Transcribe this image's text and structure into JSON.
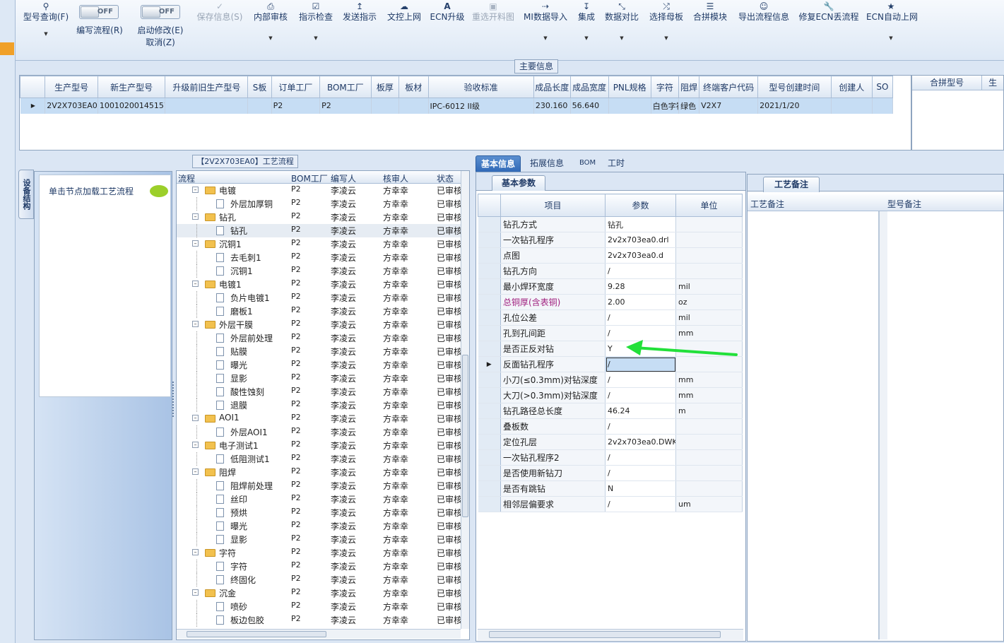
{
  "toolbar": {
    "model_query": "型号查询(F)",
    "write_flow": "编写流程(R)",
    "auto_modify": "启动修改(E)",
    "cancel": "取消(Z)",
    "toggle_off": "OFF",
    "save_info": "保存信息(S)",
    "internal_review": "内部审核",
    "guide_check": "指示检查",
    "send_guide": "发送指示",
    "doc_online": "文控上网",
    "ecn_upgrade": "ECN升级",
    "reselect_cut": "重选开料图",
    "mi_import": "MI数据导入",
    "integrate": "集成",
    "data_compare": "数据对比",
    "select_mother": "选择母板",
    "combine_module": "合拼模块",
    "export_flow": "导出流程信息",
    "repair_ecn": "修复ECN丢流程",
    "ecn_auto": "ECN自动上网"
  },
  "main_info": {
    "label": "主要信息",
    "columns": [
      "生产型号",
      "新生产型号",
      "升级前旧生产型号",
      "S板",
      "订单工厂",
      "BOM工厂",
      "板厚",
      "板材",
      "验收标准",
      "成品长度",
      "成品宽度",
      "PNL规格",
      "字符",
      "阻焊",
      "终端客户代码",
      "型号创建时间",
      "创建人",
      "SO"
    ],
    "row": [
      "2V2X703EA0",
      "10010200145157",
      "",
      "",
      "P2",
      "P2",
      "",
      "",
      "IPC-6012 II级",
      "230.160",
      "56.640",
      "",
      "白色字符",
      "绿色",
      "V2X7",
      "2021/1/20",
      "",
      ""
    ],
    "merge_header": "合拼型号",
    "merge_header2": "生"
  },
  "flow_panel": {
    "title": "【2V2X703EA0】工艺流程",
    "side_tab": "设备结构",
    "load_hint": "单击节点加载工艺流程",
    "columns": [
      "流程",
      "BOM工厂",
      "编写人",
      "核审人",
      "状态"
    ],
    "rows": [
      {
        "level": 0,
        "name": "电镀",
        "bom": "P2",
        "author": "李凌云",
        "reviewer": "方幸幸",
        "status": "已审核"
      },
      {
        "level": 1,
        "name": "外层加厚铜",
        "bom": "P2",
        "author": "李凌云",
        "reviewer": "方幸幸",
        "status": "已审核"
      },
      {
        "level": 0,
        "name": "钻孔",
        "bom": "P2",
        "author": "李凌云",
        "reviewer": "方幸幸",
        "status": "已审核"
      },
      {
        "level": 1,
        "name": "钻孔",
        "bom": "P2",
        "author": "李凌云",
        "reviewer": "方幸幸",
        "status": "已审核",
        "selected": true
      },
      {
        "level": 0,
        "name": "沉铜1",
        "bom": "P2",
        "author": "李凌云",
        "reviewer": "方幸幸",
        "status": "已审核"
      },
      {
        "level": 1,
        "name": "去毛刺1",
        "bom": "P2",
        "author": "李凌云",
        "reviewer": "方幸幸",
        "status": "已审核"
      },
      {
        "level": 1,
        "name": "沉铜1",
        "bom": "P2",
        "author": "李凌云",
        "reviewer": "方幸幸",
        "status": "已审核"
      },
      {
        "level": 0,
        "name": "电镀1",
        "bom": "P2",
        "author": "李凌云",
        "reviewer": "方幸幸",
        "status": "已审核"
      },
      {
        "level": 1,
        "name": "负片电镀1",
        "bom": "P2",
        "author": "李凌云",
        "reviewer": "方幸幸",
        "status": "已审核"
      },
      {
        "level": 1,
        "name": "磨板1",
        "bom": "P2",
        "author": "李凌云",
        "reviewer": "方幸幸",
        "status": "已审核"
      },
      {
        "level": 0,
        "name": "外层干膜",
        "bom": "P2",
        "author": "李凌云",
        "reviewer": "方幸幸",
        "status": "已审核"
      },
      {
        "level": 1,
        "name": "外层前处理",
        "bom": "P2",
        "author": "李凌云",
        "reviewer": "方幸幸",
        "status": "已审核"
      },
      {
        "level": 1,
        "name": "贴膜",
        "bom": "P2",
        "author": "李凌云",
        "reviewer": "方幸幸",
        "status": "已审核"
      },
      {
        "level": 1,
        "name": "曝光",
        "bom": "P2",
        "author": "李凌云",
        "reviewer": "方幸幸",
        "status": "已审核"
      },
      {
        "level": 1,
        "name": "显影",
        "bom": "P2",
        "author": "李凌云",
        "reviewer": "方幸幸",
        "status": "已审核"
      },
      {
        "level": 1,
        "name": "酸性蚀刻",
        "bom": "P2",
        "author": "李凌云",
        "reviewer": "方幸幸",
        "status": "已审核"
      },
      {
        "level": 1,
        "name": "退膜",
        "bom": "P2",
        "author": "李凌云",
        "reviewer": "方幸幸",
        "status": "已审核"
      },
      {
        "level": 0,
        "name": "AOI1",
        "bom": "P2",
        "author": "李凌云",
        "reviewer": "方幸幸",
        "status": "已审核"
      },
      {
        "level": 1,
        "name": "外层AOI1",
        "bom": "P2",
        "author": "李凌云",
        "reviewer": "方幸幸",
        "status": "已审核"
      },
      {
        "level": 0,
        "name": "电子测试1",
        "bom": "P2",
        "author": "李凌云",
        "reviewer": "方幸幸",
        "status": "已审核"
      },
      {
        "level": 1,
        "name": "低阻测试1",
        "bom": "P2",
        "author": "李凌云",
        "reviewer": "方幸幸",
        "status": "已审核"
      },
      {
        "level": 0,
        "name": "阻焊",
        "bom": "P2",
        "author": "李凌云",
        "reviewer": "方幸幸",
        "status": "已审核"
      },
      {
        "level": 1,
        "name": "阻焊前处理",
        "bom": "P2",
        "author": "李凌云",
        "reviewer": "方幸幸",
        "status": "已审核"
      },
      {
        "level": 1,
        "name": "丝印",
        "bom": "P2",
        "author": "李凌云",
        "reviewer": "方幸幸",
        "status": "已审核"
      },
      {
        "level": 1,
        "name": "预烘",
        "bom": "P2",
        "author": "李凌云",
        "reviewer": "方幸幸",
        "status": "已审核"
      },
      {
        "level": 1,
        "name": "曝光",
        "bom": "P2",
        "author": "李凌云",
        "reviewer": "方幸幸",
        "status": "已审核"
      },
      {
        "level": 1,
        "name": "显影",
        "bom": "P2",
        "author": "李凌云",
        "reviewer": "方幸幸",
        "status": "已审核"
      },
      {
        "level": 0,
        "name": "字符",
        "bom": "P2",
        "author": "李凌云",
        "reviewer": "方幸幸",
        "status": "已审核"
      },
      {
        "level": 1,
        "name": "字符",
        "bom": "P2",
        "author": "李凌云",
        "reviewer": "方幸幸",
        "status": "已审核"
      },
      {
        "level": 1,
        "name": "终固化",
        "bom": "P2",
        "author": "李凌云",
        "reviewer": "方幸幸",
        "status": "已审核"
      },
      {
        "level": 0,
        "name": "沉金",
        "bom": "P2",
        "author": "李凌云",
        "reviewer": "方幸幸",
        "status": "已审核"
      },
      {
        "level": 1,
        "name": "喷砂",
        "bom": "P2",
        "author": "李凌云",
        "reviewer": "方幸幸",
        "status": "已审核"
      },
      {
        "level": 1,
        "name": "板边包胶",
        "bom": "P2",
        "author": "李凌云",
        "reviewer": "方幸幸",
        "status": "已审核"
      }
    ]
  },
  "detail": {
    "tabs": [
      "基本信息",
      "拓展信息",
      "BOM",
      "工时"
    ],
    "subtab": "基本参数",
    "columns": [
      "项目",
      "参数",
      "单位"
    ],
    "params": [
      {
        "name": "钻孔方式",
        "value": "钻孔",
        "unit": ""
      },
      {
        "name": "一次钻孔程序",
        "value": "2v2x703ea0.drl",
        "unit": ""
      },
      {
        "name": "点图",
        "value": "2v2x703ea0.d",
        "unit": ""
      },
      {
        "name": "钻孔方向",
        "value": "/",
        "unit": ""
      },
      {
        "name": "最小焊环宽度",
        "value": "9.28",
        "unit": "mil"
      },
      {
        "name": "总铜厚(含表铜)",
        "value": "2.00",
        "unit": "oz",
        "highlight": true
      },
      {
        "name": "孔位公差",
        "value": "/",
        "unit": "mil"
      },
      {
        "name": "孔到孔间距",
        "value": "/",
        "unit": "mm"
      },
      {
        "name": "是否正反对钻",
        "value": "Y",
        "unit": ""
      },
      {
        "name": "反面钻孔程序",
        "value": "/",
        "unit": "",
        "current": true
      },
      {
        "name": "小刀(≤0.3mm)对钻深度",
        "value": "/",
        "unit": "mm"
      },
      {
        "name": "大刀(>0.3mm)对钻深度",
        "value": "/",
        "unit": "mm"
      },
      {
        "name": "钻孔路径总长度",
        "value": "46.24",
        "unit": "m"
      },
      {
        "name": "叠板数",
        "value": "/",
        "unit": ""
      },
      {
        "name": "定位孔层",
        "value": "2v2x703ea0.DWK",
        "unit": ""
      },
      {
        "name": "一次钻孔程序2",
        "value": "/",
        "unit": ""
      },
      {
        "name": "是否使用新钻刀",
        "value": "/",
        "unit": ""
      },
      {
        "name": "是否有跳钻",
        "value": "N",
        "unit": ""
      },
      {
        "name": "相邻层偏要求",
        "value": "/",
        "unit": "um"
      }
    ]
  },
  "remarks": {
    "title": "工艺备注",
    "col1": "工艺备注",
    "col2": "型号备注"
  },
  "colors": {
    "accent": "#2f68b6",
    "selected_row": "#c6ddf4",
    "arrow": "#22e03a",
    "highlight_text": "#a0207f"
  }
}
